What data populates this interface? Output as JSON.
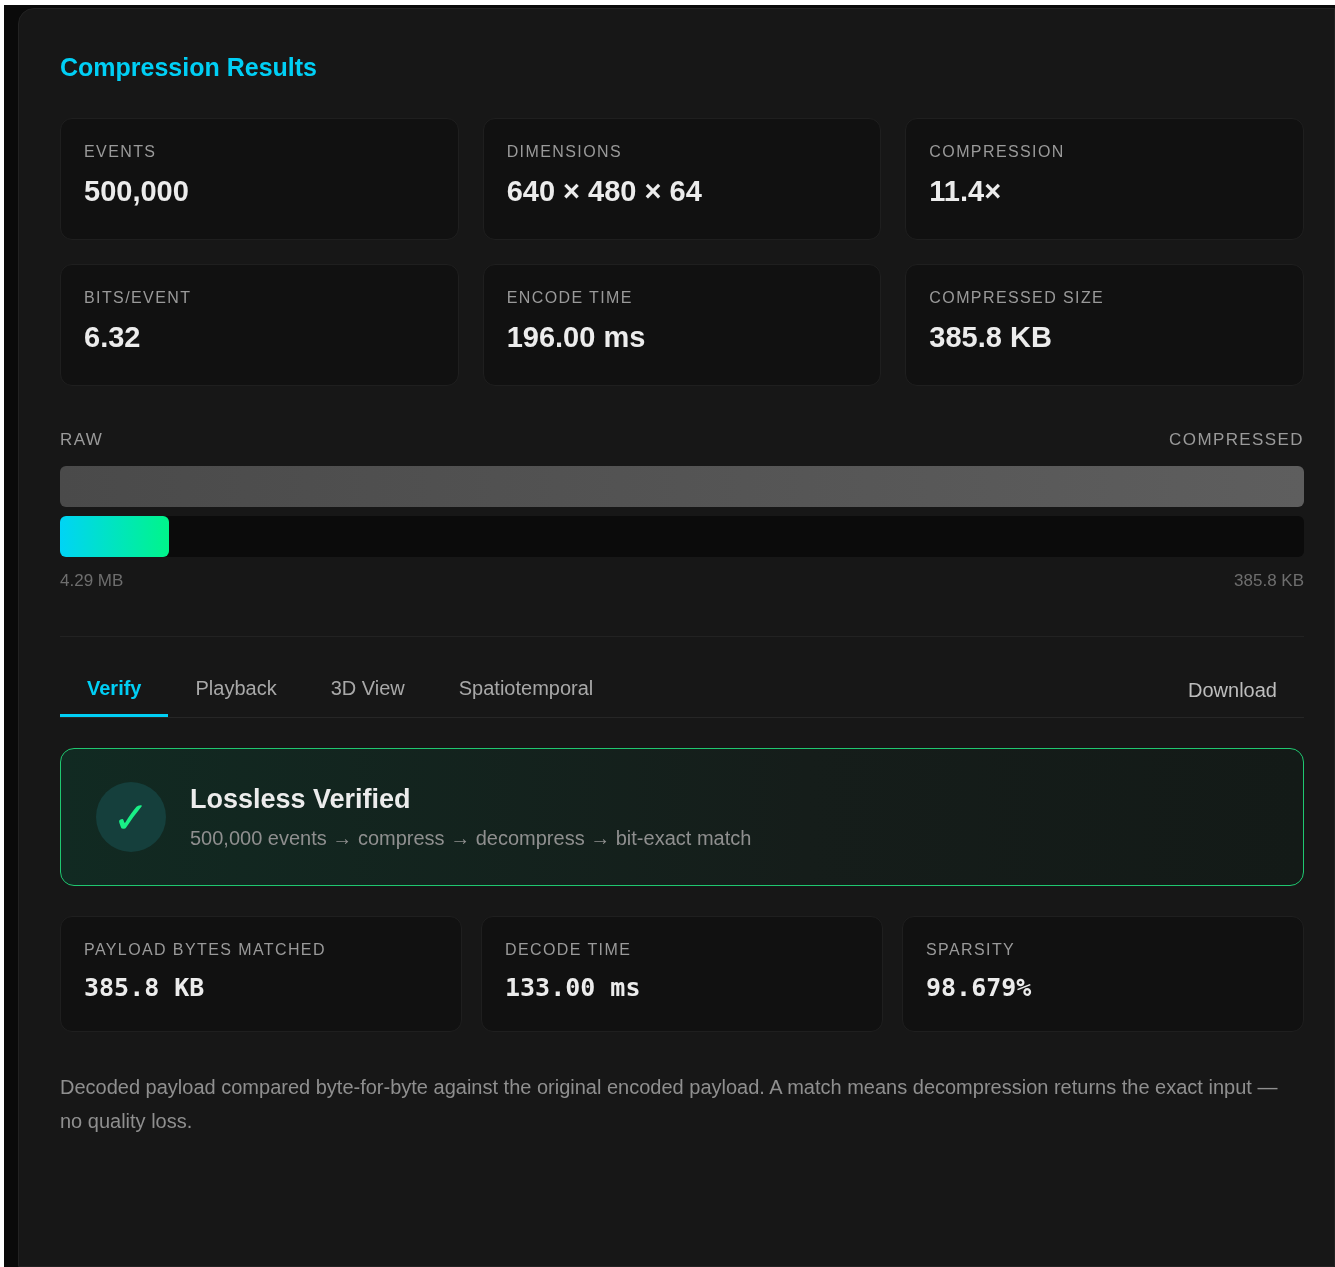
{
  "title": "Compression Results",
  "stats": [
    {
      "label": "EVENTS",
      "value": "500,000"
    },
    {
      "label": "DIMENSIONS",
      "value": "640 × 480 × 64"
    },
    {
      "label": "COMPRESSION",
      "value": "11.4×"
    },
    {
      "label": "BITS/EVENT",
      "value": "6.32"
    },
    {
      "label": "ENCODE TIME",
      "value": "196.00 ms"
    },
    {
      "label": "COMPRESSED SIZE",
      "value": "385.8 KB"
    }
  ],
  "size_bars": {
    "left_label": "RAW",
    "right_label": "COMPRESSED",
    "bars": [
      {
        "kind": "raw"
      },
      {
        "kind": "compressed",
        "level": 0.088
      }
    ],
    "left_reading": "4.29 MB",
    "right_reading": "385.8 KB"
  },
  "tabs": [
    {
      "label": "Verify",
      "selected": true
    },
    {
      "label": "Playback",
      "selected": false
    },
    {
      "label": "3D View",
      "selected": false
    },
    {
      "label": "Spatiotemporal",
      "selected": false
    }
  ],
  "download": "Download",
  "verify": {
    "icon": "✓",
    "title": "Lossless Verified",
    "detail": "500,000 events → compress → decompress → bit-exact match"
  },
  "verify_stats": [
    {
      "label": "PAYLOAD BYTES MATCHED",
      "value": "385.8 KB"
    },
    {
      "label": "DECODE TIME",
      "value": "133.00 ms"
    },
    {
      "label": "SPARSITY",
      "value": "98.679%"
    }
  ],
  "note": "Decoded payload compared byte-for-byte against the original encoded payload. A match means decompression returns the exact input — no quality loss."
}
